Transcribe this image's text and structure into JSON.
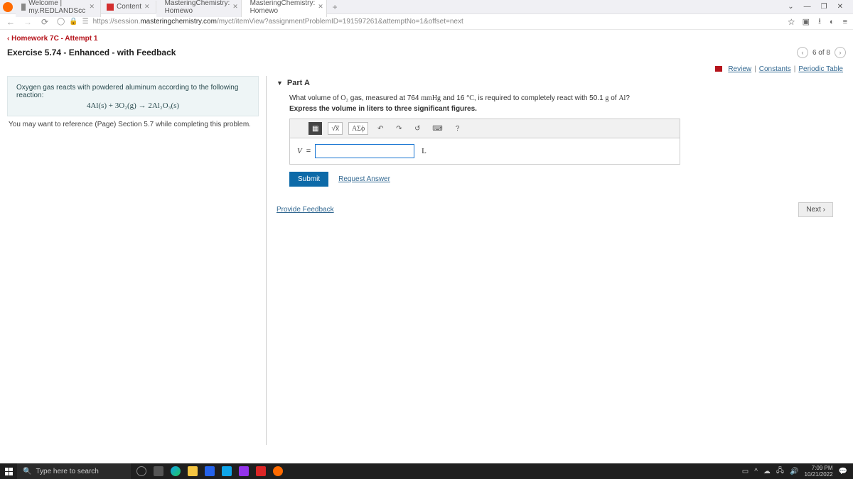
{
  "browser": {
    "tabs": [
      {
        "label": "Welcome | my.REDLANDScc"
      },
      {
        "label": "Content"
      },
      {
        "label": "MasteringChemistry: Homewo"
      },
      {
        "label": "MasteringChemistry: Homewo"
      }
    ],
    "url_prefix": "https://session.",
    "url_host": "masteringchemistry.com",
    "url_path": "/myct/itemView?assignmentProblemID=191597261&attemptNo=1&offset=next"
  },
  "page": {
    "breadcrumb": "Homework 7C - Attempt 1",
    "title": "Exercise 5.74 - Enhanced - with Feedback",
    "pager": "6 of 8",
    "links": {
      "review": "Review",
      "constants": "Constants",
      "periodic": "Periodic Table"
    }
  },
  "left": {
    "intro": "Oxygen gas reacts with powdered aluminum according to the following reaction:",
    "equation": "4Al(s) + 3O₂(g) → 2Al₂O₃(s)",
    "ref": "You may want to reference (Page) Section 5.7 while completing this problem."
  },
  "part": {
    "label": "Part A",
    "question_pre": "What volume of ",
    "question_o2": "O₂",
    "question_mid": " gas, measured at 764 ",
    "question_mmhg": "mmHg",
    "question_mid2": " and 16 ",
    "question_degc": "°C",
    "question_mid3": ", is required to completely react with 50.1 ",
    "question_g": "g",
    "question_mid4": " of ",
    "question_al": "Al",
    "question_end": "?",
    "instruction": "Express the volume in liters to three significant figures.",
    "toolbar": {
      "templates": "▦",
      "sqrt": "√x̅",
      "greek": "ΑΣϕ",
      "undo": "↶",
      "redo": "↷",
      "reset": "↺",
      "keyboard": "⌨",
      "help": "?"
    },
    "var": "V",
    "eq": " = ",
    "unit": "L",
    "submit": "Submit",
    "request": "Request Answer"
  },
  "footer": {
    "provide": "Provide Feedback",
    "next": "Next ›"
  },
  "taskbar": {
    "search_placeholder": "Type here to search",
    "time": "7:09 PM",
    "date": "10/21/2022"
  }
}
